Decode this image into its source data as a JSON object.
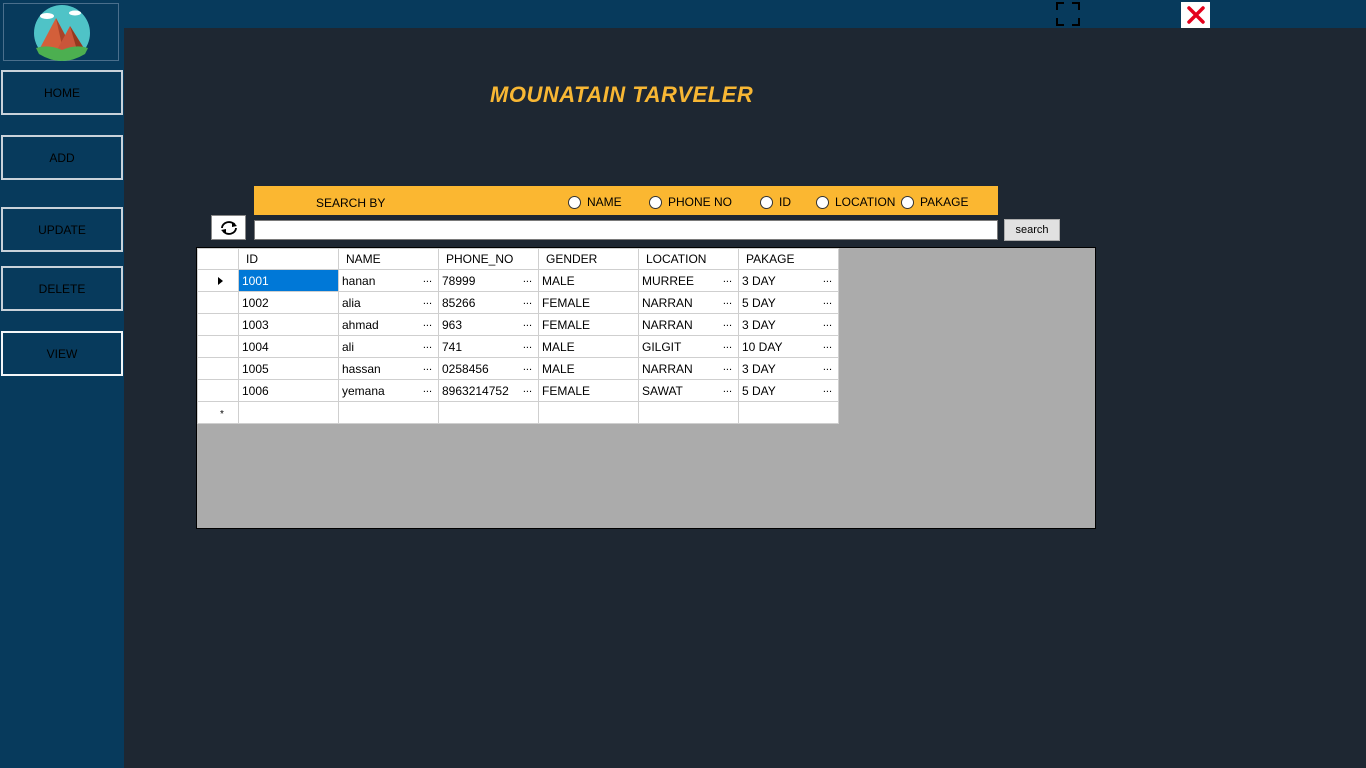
{
  "app": {
    "title": "MOUNATAIN TARVELER"
  },
  "icons": {
    "logo": "mountain-logo-icon",
    "fullscreen": "fullscreen-icon",
    "close": "close-icon",
    "refresh": "refresh-icon"
  },
  "colors": {
    "accent": "#fbb731",
    "sidebar": "#073a5c",
    "background": "#1e2732",
    "selection": "#0078d7",
    "close": "#e4001b"
  },
  "sidebar": {
    "items": [
      {
        "label": "HOME"
      },
      {
        "label": "ADD"
      },
      {
        "label": "UPDATE"
      },
      {
        "label": "DELETE"
      },
      {
        "label": "VIEW"
      }
    ]
  },
  "search": {
    "label": "SEARCH BY",
    "options": [
      "NAME",
      "PHONE NO",
      "ID",
      "LOCATION",
      "PAKAGE"
    ],
    "value": "",
    "button_label": "search"
  },
  "table": {
    "columns": [
      "ID",
      "NAME",
      "PHONE_NO",
      "GENDER",
      "LOCATION",
      "PAKAGE"
    ],
    "rows": [
      [
        "1001",
        "hanan",
        "78999",
        "MALE",
        "MURREE",
        "3 DAY"
      ],
      [
        "1002",
        "alia",
        "85266",
        "FEMALE",
        "NARRAN",
        "5 DAY"
      ],
      [
        "1003",
        "ahmad",
        "963",
        "FEMALE",
        "NARRAN",
        "3 DAY"
      ],
      [
        "1004",
        "ali",
        "741",
        "MALE",
        "GILGIT",
        "10 DAY"
      ],
      [
        "1005",
        "hassan",
        "0258456",
        "MALE",
        "NARRAN",
        "3 DAY"
      ],
      [
        "1006",
        "yemana",
        "8963214752",
        "FEMALE",
        "SAWAT",
        "5 DAY"
      ]
    ],
    "ellipsis": "...",
    "new_row_marker": "*"
  }
}
